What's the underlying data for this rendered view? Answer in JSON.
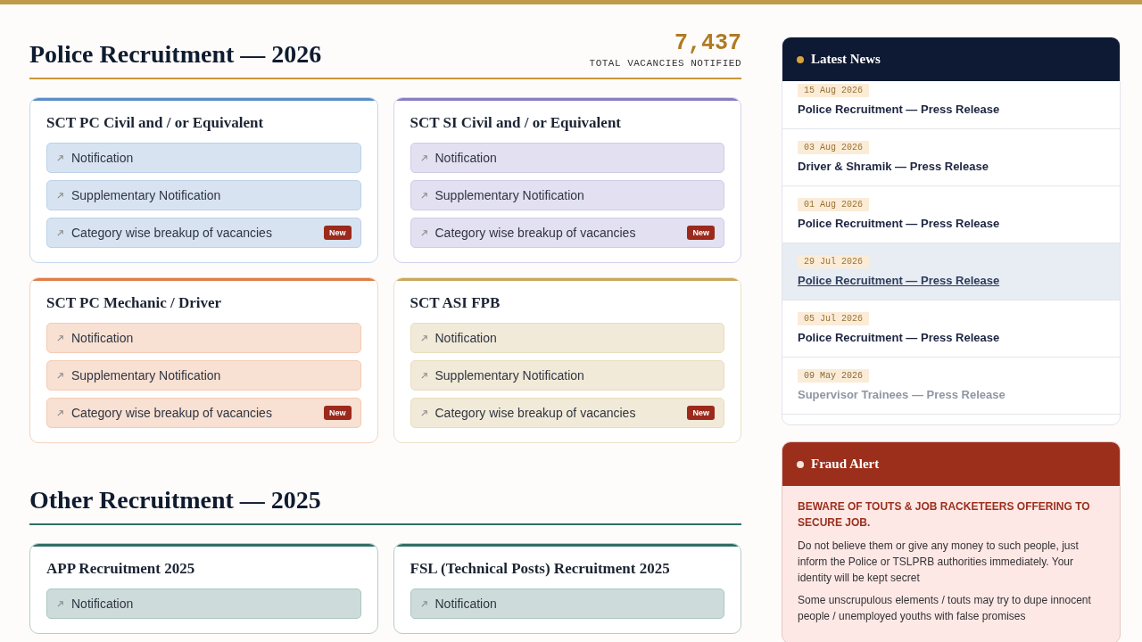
{
  "sections": [
    {
      "title": "Police Recruitment — 2026",
      "kind": "current",
      "stat": {
        "value": "7,437",
        "label": "TOTAL VACANCIES NOTIFIED"
      },
      "cards": [
        {
          "title": "SCT PC Civil and / or Equivalent",
          "color": "#5b8cc9",
          "links": [
            {
              "label": "Notification",
              "new": false
            },
            {
              "label": "Supplementary Notification",
              "new": false
            },
            {
              "label": "Category wise breakup of vacancies",
              "new": true,
              "badge": "New"
            }
          ]
        },
        {
          "title": "SCT SI Civil and / or Equivalent",
          "color": "#8a7cc4",
          "links": [
            {
              "label": "Notification",
              "new": false
            },
            {
              "label": "Supplementary Notification",
              "new": false
            },
            {
              "label": "Category wise breakup of vacancies",
              "new": true,
              "badge": "New"
            }
          ]
        },
        {
          "title": "SCT PC Mechanic / Driver",
          "color": "#e07d45",
          "links": [
            {
              "label": "Notification",
              "new": false
            },
            {
              "label": "Supplementary Notification",
              "new": false
            },
            {
              "label": "Category wise breakup of vacancies",
              "new": true,
              "badge": "New"
            }
          ]
        },
        {
          "title": "SCT ASI FPB",
          "color": "#c9a85c",
          "links": [
            {
              "label": "Notification",
              "new": false
            },
            {
              "label": "Supplementary Notification",
              "new": false
            },
            {
              "label": "Category wise breakup of vacancies",
              "new": true,
              "badge": "New"
            }
          ]
        }
      ]
    },
    {
      "title": "Other Recruitment — 2025",
      "kind": "other",
      "cards": [
        {
          "title": "APP Recruitment 2025",
          "color": "#2f6f66",
          "links": [
            {
              "label": "Notification",
              "new": false
            }
          ]
        },
        {
          "title": "FSL (Technical Posts) Recruitment 2025",
          "color": "#2f6f66",
          "links": [
            {
              "label": "Notification",
              "new": false
            }
          ]
        }
      ]
    }
  ],
  "latest_news": {
    "title": "Latest News",
    "items": [
      {
        "date": "15 Aug 2026",
        "title": "Police Recruitment — Press Release",
        "selected": false
      },
      {
        "date": "03 Aug 2026",
        "title": "Driver & Shramik — Press Release",
        "selected": false
      },
      {
        "date": "01 Aug 2026",
        "title": "Police Recruitment — Press Release",
        "selected": false
      },
      {
        "date": "29 Jul 2026",
        "title": "Police Recruitment — Press Release",
        "selected": true
      },
      {
        "date": "05 Jul 2026",
        "title": "Police Recruitment — Press Release",
        "selected": false
      },
      {
        "date": "09 May 2026",
        "title": "Supervisor Trainees — Press Release",
        "selected": false
      }
    ]
  },
  "fraud_alert": {
    "title": "Fraud Alert",
    "warning": "BEWARE OF TOUTS & JOB RACKETEERS OFFERING TO SECURE JOB.",
    "paragraphs": [
      "Do not believe them or give any money to such people, just inform the Police or TSLPRB authorities immediately. Your identity will be kept secret",
      "Some unscrupulous elements / touts may try to dupe innocent people / unemployed youths with false promises"
    ]
  }
}
